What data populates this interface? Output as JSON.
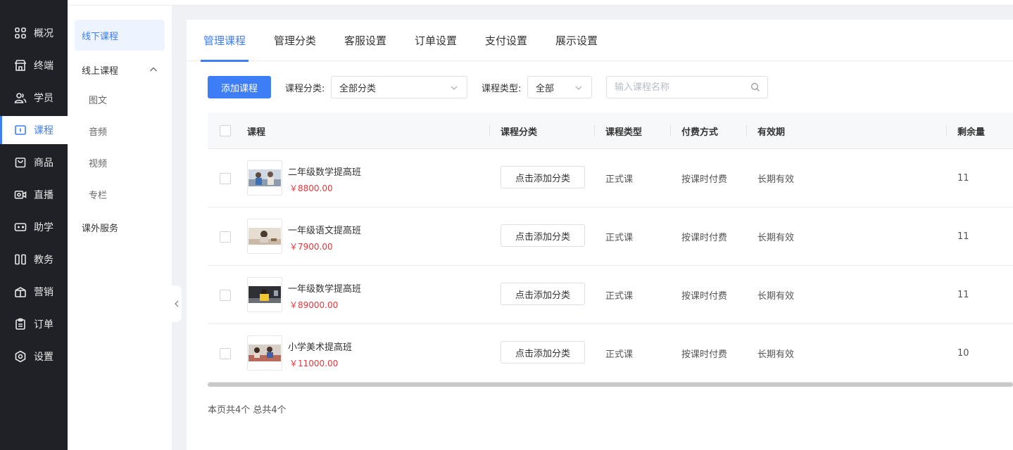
{
  "nav": {
    "items": [
      {
        "label": "概况",
        "icon": "grid-icon"
      },
      {
        "label": "终端",
        "icon": "store-icon"
      },
      {
        "label": "学员",
        "icon": "users-icon"
      },
      {
        "label": "课程",
        "icon": "course-icon"
      },
      {
        "label": "商品",
        "icon": "bag-icon"
      },
      {
        "label": "直播",
        "icon": "camera-icon"
      },
      {
        "label": "助学",
        "icon": "gamepad-icon"
      },
      {
        "label": "教务",
        "icon": "books-icon"
      },
      {
        "label": "营销",
        "icon": "gift-icon"
      },
      {
        "label": "订单",
        "icon": "clipboard-icon"
      },
      {
        "label": "设置",
        "icon": "hexagon-gear-icon"
      }
    ],
    "active": "课程"
  },
  "submenu": {
    "items": [
      {
        "label": "线下课程"
      },
      {
        "label": "线上课程"
      },
      {
        "label": "图文"
      },
      {
        "label": "音频"
      },
      {
        "label": "视频"
      },
      {
        "label": "专栏"
      },
      {
        "label": "课外服务"
      }
    ]
  },
  "tabs": [
    {
      "label": "管理课程"
    },
    {
      "label": "管理分类"
    },
    {
      "label": "客服设置"
    },
    {
      "label": "订单设置"
    },
    {
      "label": "支付设置"
    },
    {
      "label": "展示设置"
    }
  ],
  "toolbar": {
    "add_label": "添加课程",
    "category_label": "课程分类:",
    "category_value": "全部分类",
    "type_label": "课程类型:",
    "type_value": "全部",
    "search_placeholder": "输入课程名称"
  },
  "table": {
    "headers": {
      "course": "课程",
      "category": "课程分类",
      "type": "课程类型",
      "pay": "付费方式",
      "validity": "有效期",
      "remain": "剩余量"
    },
    "rows": [
      {
        "name": "二年级数学提高班",
        "price": "￥8800.00",
        "category_btn": "点击添加分类",
        "type": "正式课",
        "pay": "按课时付费",
        "validity": "长期有效",
        "remain": "11"
      },
      {
        "name": "一年级语文提高班",
        "price": "￥7900.00",
        "category_btn": "点击添加分类",
        "type": "正式课",
        "pay": "按课时付费",
        "validity": "长期有效",
        "remain": "11"
      },
      {
        "name": "一年级数学提高班",
        "price": "￥89000.00",
        "category_btn": "点击添加分类",
        "type": "正式课",
        "pay": "按课时付费",
        "validity": "长期有效",
        "remain": "11"
      },
      {
        "name": "小学美术提高班",
        "price": "￥11000.00",
        "category_btn": "点击添加分类",
        "type": "正式课",
        "pay": "按课时付费",
        "validity": "长期有效",
        "remain": "10"
      }
    ]
  },
  "footer": {
    "summary": "本页共4个 总共4个"
  },
  "colors": {
    "accent": "#3d7df6",
    "price": "#e4393c",
    "nav_bg": "#1f2126"
  }
}
